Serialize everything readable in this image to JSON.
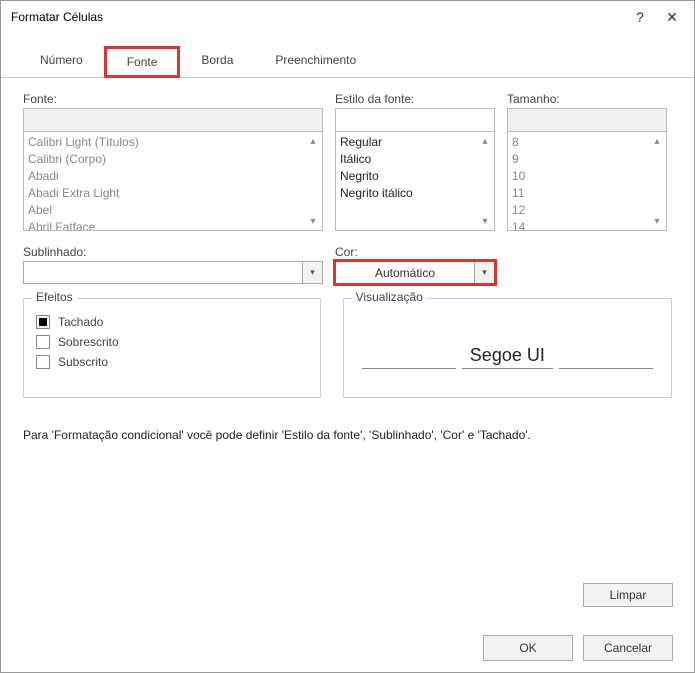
{
  "title": "Formatar Células",
  "help_glyph": "?",
  "close_glyph": "✕",
  "tabs": {
    "t0": "Número",
    "t1": "Fonte",
    "t2": "Borda",
    "t3": "Preenchimento",
    "active_index": 1
  },
  "labels": {
    "font": "Fonte:",
    "style": "Estilo da fonte:",
    "size": "Tamanho:",
    "underline": "Sublinhado:",
    "color": "Cor:",
    "effects": "Efeitos",
    "preview": "Visualização"
  },
  "font_list": {
    "i0": "Calibri Light (Títulos)",
    "i1": "Calibri (Corpo)",
    "i2": "Abadi",
    "i3": "Abadi Extra Light",
    "i4": "Abel",
    "i5": "Abril Fatface"
  },
  "style_list": {
    "i0": "Regular",
    "i1": "Itálico",
    "i2": "Negrito",
    "i3": "Negrito itálico"
  },
  "size_list": {
    "i0": "8",
    "i1": "9",
    "i2": "10",
    "i3": "11",
    "i4": "12",
    "i5": "14"
  },
  "underline_value": "",
  "color_value": "Automático",
  "effects": {
    "strike": "Tachado",
    "super": "Sobrescrito",
    "sub": "Subscrito"
  },
  "preview_sample": "Segoe UI",
  "note": "Para 'Formatação condicional' você pode definir 'Estilo da fonte', 'Sublinhado', 'Cor' e 'Tachado'.",
  "buttons": {
    "clear": "Limpar",
    "ok": "OK",
    "cancel": "Cancelar"
  },
  "glyphs": {
    "chev_down": "▾",
    "chev_up": "▴"
  }
}
